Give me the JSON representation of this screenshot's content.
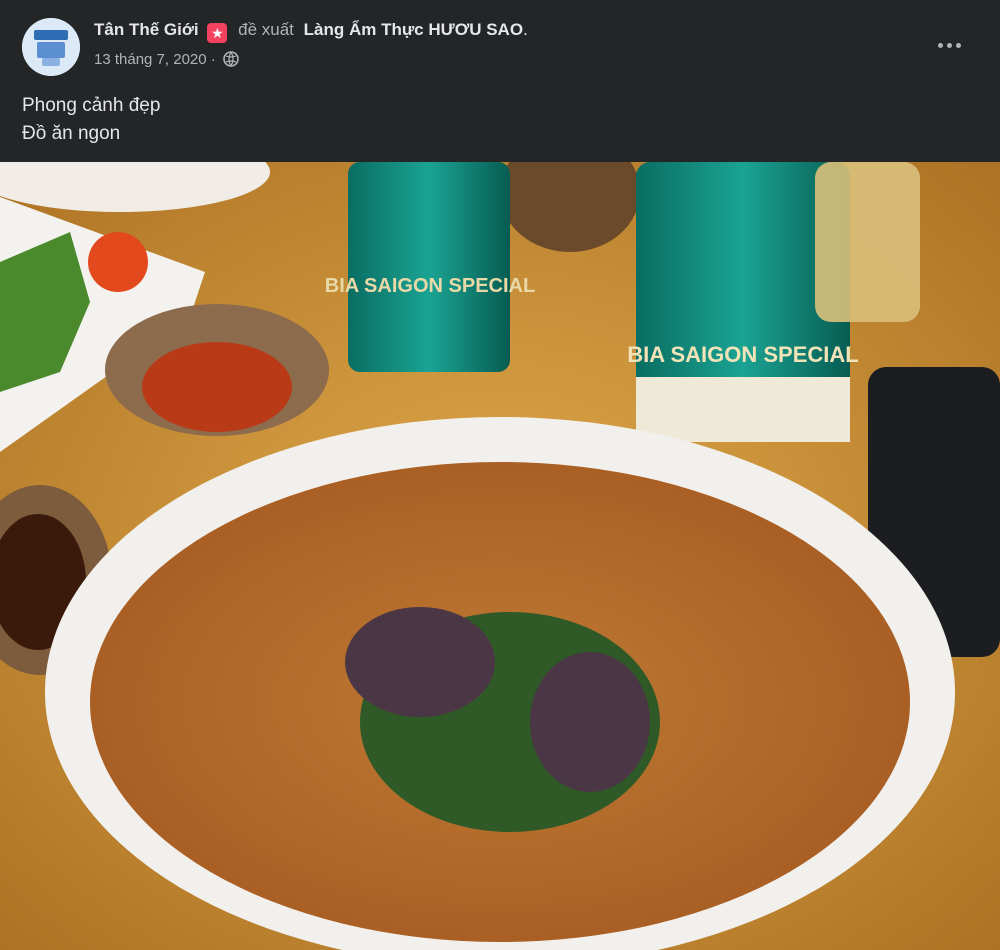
{
  "post": {
    "author": "Tân Thế Giới",
    "action": "đề xuất",
    "page_name": "Làng Ẩm Thực HƯƠU SAO",
    "date": "13 tháng 7, 2020",
    "separator": "·",
    "privacy_icon": "globe-icon",
    "more_icon": "more-options-icon",
    "text_lines": [
      "Phong cảnh đẹp",
      "Đồ ăn ngon"
    ]
  },
  "photo": {
    "can_left_text": "BIA SAIGON SPECIAL",
    "can_right_text": "BIA SAIGON SPECIAL"
  },
  "colors": {
    "background": "#242526",
    "text_primary": "#e4e6eb",
    "text_secondary": "#b0b3b8"
  }
}
